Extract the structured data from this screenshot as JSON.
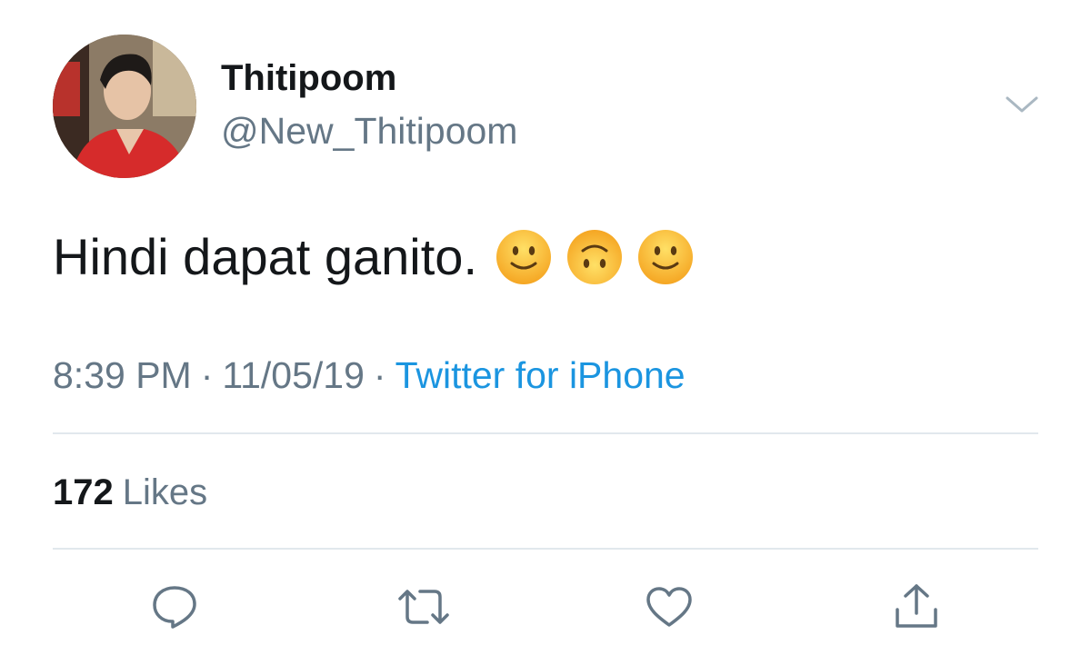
{
  "user": {
    "display_name": "Thitipoom",
    "handle": "@New_Thitipoom",
    "avatar_icon": "profile-photo"
  },
  "tweet": {
    "text": "Hindi dapat ganito.",
    "emojis": [
      "slightly-smiling-face",
      "upside-down-face",
      "slightly-smiling-face"
    ],
    "time": "8:39 PM",
    "date": "11/05/19",
    "separator": "·",
    "source": "Twitter for iPhone"
  },
  "stats": {
    "likes_count": "172",
    "likes_label": "Likes"
  },
  "actions": [
    "reply-icon",
    "retweet-icon",
    "like-icon",
    "share-icon"
  ],
  "colors": {
    "text": "#14171a",
    "secondary": "#657786",
    "link": "#1b95e0",
    "divider": "#e1e8ed",
    "emoji_face": "#fcc419"
  }
}
